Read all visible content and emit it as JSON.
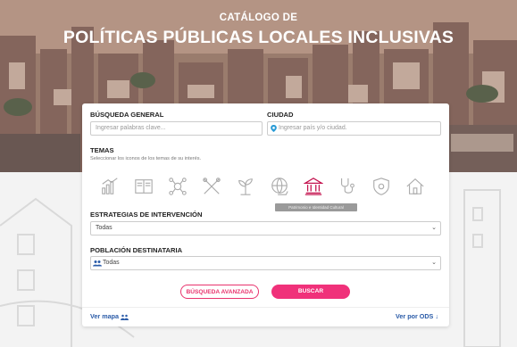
{
  "header": {
    "subtitle": "CATÁLOGO DE",
    "title": "POLÍTICAS PÚBLICAS LOCALES INCLUSIVAS"
  },
  "search": {
    "general_label": "BÚSQUEDA GENERAL",
    "general_placeholder": "Ingresar palabras clave...",
    "city_label": "CIUDAD",
    "city_placeholder": "Ingresar país y/o ciudad."
  },
  "themes": {
    "label": "TEMAS",
    "hint": "Seleccionar los iconos de los temas de su interés.",
    "items": [
      {
        "icon": "chart-growth-icon"
      },
      {
        "icon": "book-icon"
      },
      {
        "icon": "people-network-icon"
      },
      {
        "icon": "tools-icon"
      },
      {
        "icon": "plant-sprout-icon"
      },
      {
        "icon": "globe-hand-icon"
      },
      {
        "icon": "museum-icon",
        "active": true
      },
      {
        "icon": "stethoscope-icon"
      },
      {
        "icon": "shield-icon"
      },
      {
        "icon": "house-icon"
      }
    ],
    "tooltip": "Patrimonio e Identidad Cultural"
  },
  "strategies": {
    "label": "ESTRATEGIAS DE INTERVENCIÓN",
    "value": "Todas"
  },
  "population": {
    "label": "POBLACIÓN DESTINATARIA",
    "value": "Todas"
  },
  "buttons": {
    "advanced": "BÚSQUEDA AVANZADA",
    "search": "BUSCAR"
  },
  "links": {
    "map": "Ver mapa",
    "ods": "Ver por ODS"
  },
  "colors": {
    "accent": "#f0317a",
    "active_icon": "#c4134f",
    "link": "#2a5ba8"
  }
}
